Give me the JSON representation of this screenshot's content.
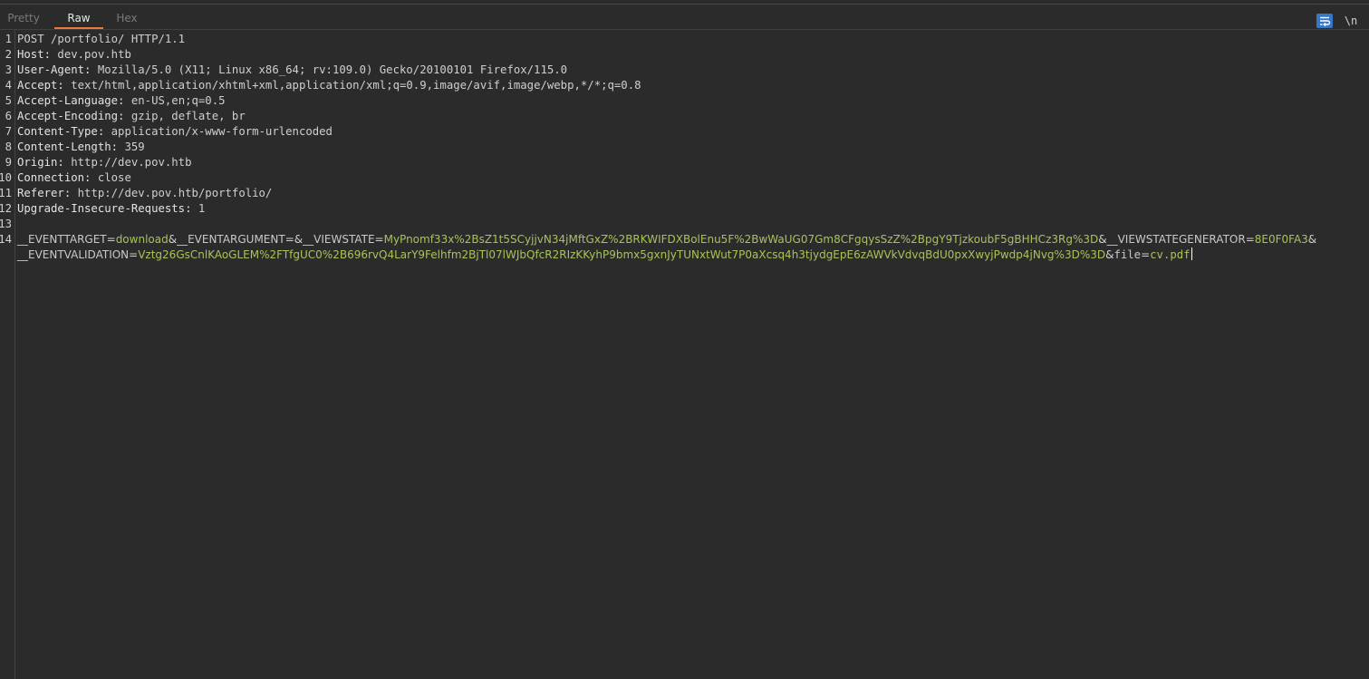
{
  "tabs": {
    "pretty": "Pretty",
    "raw": "Raw",
    "hex": "Hex",
    "active": "Raw"
  },
  "toolbar": {
    "wrap_icon": "wrap-lines-icon",
    "newline_label": "\\n"
  },
  "line_numbers": [
    "1",
    "2",
    "3",
    "4",
    "5",
    "6",
    "7",
    "8",
    "9",
    "10",
    "11",
    "12",
    "13",
    "14"
  ],
  "request": {
    "request_line": "POST /portfolio/ HTTP/1.1",
    "headers": [
      {
        "name": "Host:",
        "value": " dev.pov.htb"
      },
      {
        "name": "User-Agent:",
        "value": " Mozilla/5.0 (X11; Linux x86_64; rv:109.0) Gecko/20100101 Firefox/115.0"
      },
      {
        "name": "Accept:",
        "value": " text/html,application/xhtml+xml,application/xml;q=0.9,image/avif,image/webp,*/*;q=0.8"
      },
      {
        "name": "Accept-Language:",
        "value": " en-US,en;q=0.5"
      },
      {
        "name": "Accept-Encoding:",
        "value": " gzip, deflate, br"
      },
      {
        "name": "Content-Type:",
        "value": " application/x-www-form-urlencoded"
      },
      {
        "name": "Content-Length:",
        "value": " 359"
      },
      {
        "name": "Origin:",
        "value": " http://dev.pov.htb"
      },
      {
        "name": "Connection:",
        "value": " close"
      },
      {
        "name": "Referer:",
        "value": " http://dev.pov.htb/portfolio/"
      },
      {
        "name": "Upgrade-Insecure-Requests:",
        "value": " 1"
      }
    ],
    "body": {
      "eventtarget_key": "__EVENTTARGET",
      "eventtarget_value": "download",
      "eventargument_key": "__EVENTARGUMENT",
      "viewstate_key": "__VIEWSTATE",
      "viewstate_value": "MyPnomf33x%2BsZ1t5SCyjjvN34jMftGxZ%2BRKWIFDXBolEnu5F%2BwWaUG07Gm8CFgqysSzZ%2BpgY9TjzkoubF5gBHHCz3Rg%3D",
      "viewstategenerator_key": "__VIEWSTATEGENERATOR",
      "viewstategenerator_value": "8E0F0FA3",
      "eventvalidation_key": "__EVENTVALIDATION",
      "eventvalidation_value": "Vztg26GsCnlKAoGLEM%2FTfgUC0%2B696rvQ4LarY9Felhfm2BjTl07lWJbQfcR2RIzKKyhP9bmx5gxnJyTUNxtWut7P0aXcsq4h3tjydgEpE6zAWVkVdvqBdU0pxXwyjPwdp4jNvg%3D%3D",
      "file_key": "file",
      "file_value": "cv.pdf"
    }
  },
  "colors": {
    "background": "#2b2b2b",
    "text": "#cfcfcf",
    "param_value": "#a7c35a",
    "active_tab_underline": "#e87a3c",
    "toggle_active": "#3877c7"
  }
}
